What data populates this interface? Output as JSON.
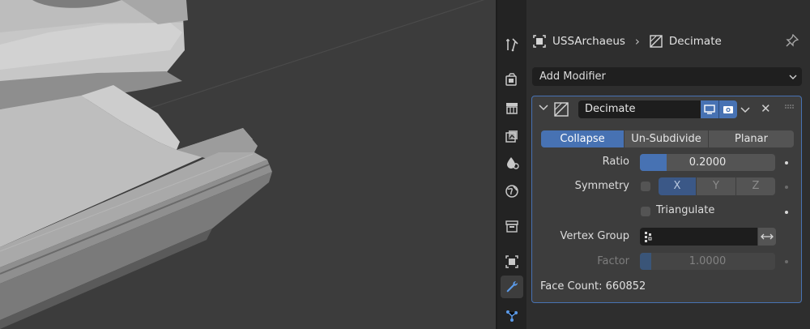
{
  "breadcrumb": {
    "object": "USSArchaeus",
    "modifier": "Decimate"
  },
  "add_modifier": {
    "label": "Add Modifier"
  },
  "modifier": {
    "name": "Decimate",
    "modes": [
      "Collapse",
      "Un-Subdivide",
      "Planar"
    ],
    "active_mode": "Collapse",
    "ratio": {
      "label": "Ratio",
      "value": "0.2000",
      "fraction": 0.2
    },
    "symmetry": {
      "label": "Symmetry",
      "checked": false,
      "axes": [
        "X",
        "Y",
        "Z"
      ],
      "active_axis": "X"
    },
    "triangulate": {
      "label": "Triangulate",
      "checked": false
    },
    "vertex_group": {
      "label": "Vertex Group",
      "value": ""
    },
    "factor": {
      "label": "Factor",
      "value": "1.0000",
      "fraction": 0.0,
      "enabled": false
    },
    "face_count": "Face Count: 660852"
  },
  "tabs": [
    "tool",
    "render",
    "output",
    "view-layer",
    "scene",
    "world",
    "collection",
    "object",
    "modifiers",
    "particles"
  ],
  "active_tab": "modifiers",
  "colors": {
    "accent": "#4772b3",
    "panel_bg": "#3d3d3d",
    "viewport_bg": "#3d3d3d"
  }
}
